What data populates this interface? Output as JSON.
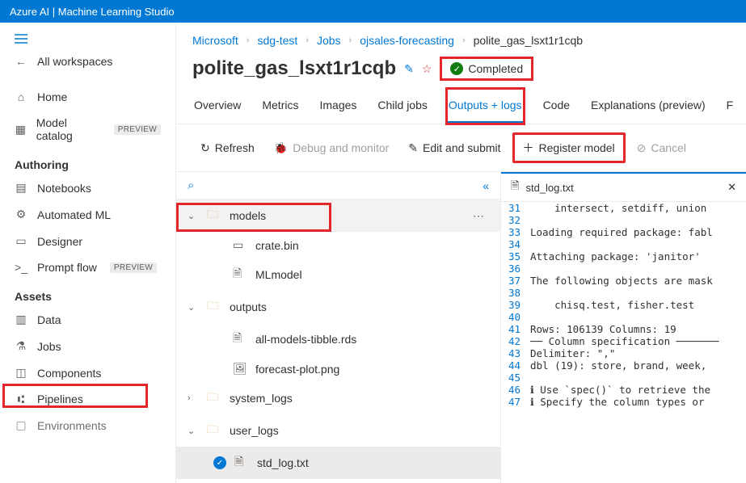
{
  "app_title": "Azure AI | Machine Learning Studio",
  "sidebar": {
    "all_workspaces": "All workspaces",
    "home": "Home",
    "model_catalog": "Model catalog",
    "preview_badge": "PREVIEW",
    "authoring_header": "Authoring",
    "notebooks": "Notebooks",
    "automated_ml": "Automated ML",
    "designer": "Designer",
    "prompt_flow": "Prompt flow",
    "assets_header": "Assets",
    "data": "Data",
    "jobs": "Jobs",
    "components": "Components",
    "pipelines": "Pipelines",
    "environments": "Environments"
  },
  "breadcrumb": {
    "b0": "Microsoft",
    "b1": "sdg-test",
    "b2": "Jobs",
    "b3": "ojsales-forecasting",
    "b4": "polite_gas_lsxt1r1cqb"
  },
  "title": "polite_gas_lsxt1r1cqb",
  "status": "Completed",
  "tabs": {
    "overview": "Overview",
    "metrics": "Metrics",
    "images": "Images",
    "child_jobs": "Child jobs",
    "outputs_logs": "Outputs + logs",
    "code": "Code",
    "explanations": "Explanations (preview)",
    "fairness": "F"
  },
  "toolbar": {
    "refresh": "Refresh",
    "debug": "Debug and monitor",
    "edit_submit": "Edit and submit",
    "register_model": "Register model",
    "cancel": "Cancel"
  },
  "tree": {
    "models": "models",
    "crate_bin": "crate.bin",
    "mlmodel": "MLmodel",
    "outputs": "outputs",
    "all_models": "all-models-tibble.rds",
    "forecast_plot": "forecast-plot.png",
    "system_logs": "system_logs",
    "user_logs": "user_logs",
    "std_log": "std_log.txt"
  },
  "log": {
    "filename": "std_log.txt",
    "lines": [
      {
        "n": "31",
        "t": "    intersect, setdiff, union"
      },
      {
        "n": "32",
        "t": ""
      },
      {
        "n": "33",
        "t": "Loading required package: fabl"
      },
      {
        "n": "34",
        "t": ""
      },
      {
        "n": "35",
        "t": "Attaching package: 'janitor'"
      },
      {
        "n": "36",
        "t": ""
      },
      {
        "n": "37",
        "t": "The following objects are mask"
      },
      {
        "n": "38",
        "t": ""
      },
      {
        "n": "39",
        "t": "    chisq.test, fisher.test"
      },
      {
        "n": "40",
        "t": ""
      },
      {
        "n": "41",
        "t": "Rows: 106139 Columns: 19"
      },
      {
        "n": "42",
        "t": "── Column specification ───────"
      },
      {
        "n": "43",
        "t": "Delimiter: \",\""
      },
      {
        "n": "44",
        "t": "dbl (19): store, brand, week, "
      },
      {
        "n": "45",
        "t": ""
      },
      {
        "n": "46",
        "t": "ℹ Use `spec()` to retrieve the"
      },
      {
        "n": "47",
        "t": "ℹ Specify the column types or "
      }
    ]
  }
}
